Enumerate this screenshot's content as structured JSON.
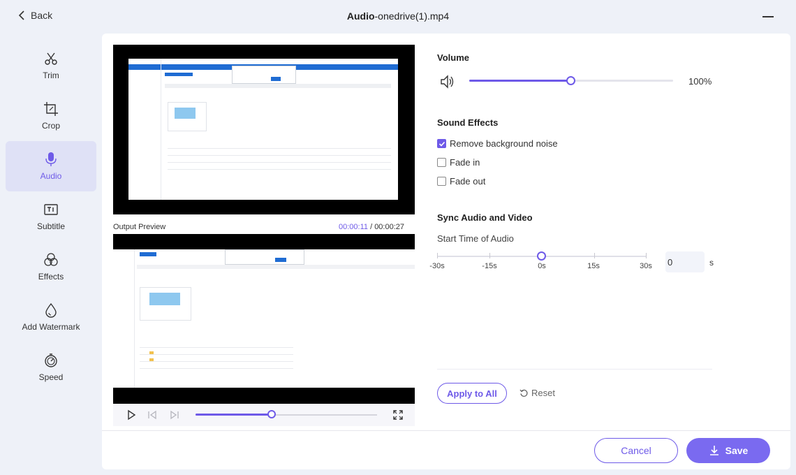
{
  "header": {
    "back_label": "Back",
    "title_bold": "Audio",
    "title_rest": "-onedrive(1).mp4"
  },
  "sidebar": {
    "items": [
      {
        "label": "Trim",
        "icon": "scissors-icon"
      },
      {
        "label": "Crop",
        "icon": "crop-icon"
      },
      {
        "label": "Audio",
        "icon": "microphone-icon",
        "active": true
      },
      {
        "label": "Subtitle",
        "icon": "subtitle-icon"
      },
      {
        "label": "Effects",
        "icon": "effects-icon"
      },
      {
        "label": "Add Watermark",
        "icon": "watermark-icon"
      },
      {
        "label": "Speed",
        "icon": "speed-icon"
      }
    ]
  },
  "preview": {
    "label": "Output Preview",
    "current_time": "00:00:11",
    "separator": " / ",
    "total_time": "00:00:27",
    "progress_fraction": 0.41
  },
  "volume": {
    "title": "Volume",
    "value": "100%",
    "slider_fraction": 0.5
  },
  "sound_effects": {
    "title": "Sound Effects",
    "options": [
      {
        "label": "Remove background noise",
        "checked": true
      },
      {
        "label": "Fade in",
        "checked": false
      },
      {
        "label": "Fade out",
        "checked": false
      }
    ]
  },
  "sync": {
    "title": "Sync Audio and Video",
    "subtitle": "Start Time of Audio",
    "ticks": [
      "-30s",
      "-15s",
      "0s",
      "15s",
      "30s"
    ],
    "value": "0",
    "unit": "s"
  },
  "actions": {
    "apply_all": "Apply to All",
    "reset": "Reset",
    "cancel": "Cancel",
    "save": "Save"
  },
  "colors": {
    "accent": "#6e5ae8",
    "save_bg": "#7a6af0",
    "active_nav_bg": "#dfe1f6",
    "app_bg": "#eef1f8"
  }
}
